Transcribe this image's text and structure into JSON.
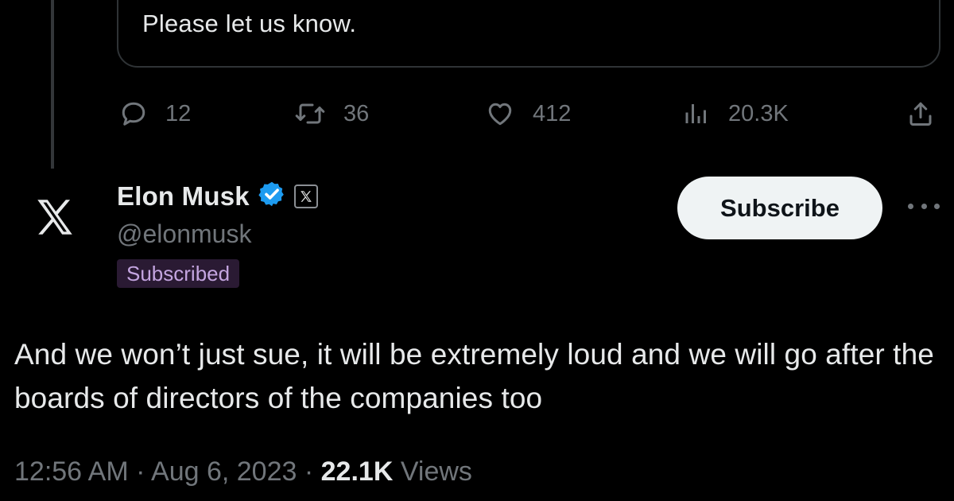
{
  "quoted_tweet": {
    "text": "Please let us know."
  },
  "actions": {
    "reply_count": "12",
    "repost_count": "36",
    "like_count": "412",
    "view_count": "20.3K",
    "icons": [
      "reply-icon",
      "repost-icon",
      "like-icon",
      "views-icon",
      "share-icon"
    ]
  },
  "author": {
    "avatar_icon": "x-logo-icon",
    "display_name": "Elon Musk",
    "verified_icon": "verified-badge-icon",
    "affiliate_icon": "x-affiliate-badge-icon",
    "handle": "@elonmusk",
    "subscribed_label": "Subscribed"
  },
  "subscribe_button": {
    "label": "Subscribe"
  },
  "more_icon": "more-icon",
  "tweet": {
    "text": "And we won’t just sue, it will be extremely loud and we will go after the boards of directors of the companies too",
    "time": "12:56 AM",
    "date": "Aug 6, 2023",
    "separator": "·",
    "views_count": "22.1K",
    "views_label": "Views"
  },
  "colors": {
    "background": "#000000",
    "text_primary": "#e7e9ea",
    "text_secondary": "#71767b",
    "verified_blue": "#1d9bf0",
    "subscribed_bg": "#2a1a33",
    "subscribed_text": "#c4a5e0",
    "button_bg": "#eff3f4"
  }
}
